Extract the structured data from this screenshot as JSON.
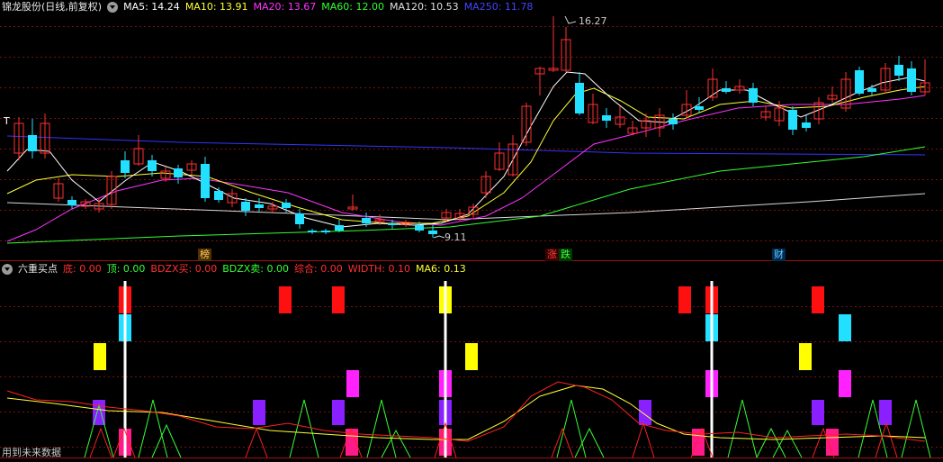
{
  "main_panel": {
    "stock_name": "锦龙股份(日线,前复权)",
    "ma_labels": [
      {
        "text": "MA5: 14.24",
        "color": "#ffffff"
      },
      {
        "text": "MA10: 13.91",
        "color": "#ffff33"
      },
      {
        "text": "MA20: 13.67",
        "color": "#ff33ff"
      },
      {
        "text": "MA60: 12.00",
        "color": "#33ff33"
      },
      {
        "text": "MA120: 10.53",
        "color": "#e0e0e0"
      },
      {
        "text": "MA250: 11.78",
        "color": "#3333ff"
      }
    ],
    "high_label": "16.27",
    "low_label": "9.11",
    "marker_t": "T",
    "event_tags": [
      {
        "text": "榜",
        "color": "#ffcc66",
        "bg": "#503000"
      },
      {
        "text": "涨",
        "color": "#ff4040",
        "bg": "#3a0000"
      },
      {
        "text": "跌",
        "color": "#40ff40",
        "bg": "#003a00"
      },
      {
        "text": "财",
        "color": "#66ccff",
        "bg": "#002a50"
      }
    ],
    "colors": {
      "up": "#ff3030",
      "down": "#22e0ff"
    }
  },
  "sub_panel": {
    "indicator_name": "六重买点",
    "values": [
      {
        "text": "底: 0.00",
        "color": "#ff3030"
      },
      {
        "text": "顶: 0.00",
        "color": "#33ff33"
      },
      {
        "text": "BDZX买: 0.00",
        "color": "#ff3030"
      },
      {
        "text": "BDZX卖: 0.00",
        "color": "#33ff33"
      },
      {
        "text": "综合: 0.00",
        "color": "#ff3030"
      },
      {
        "text": "WIDTH: 0.10",
        "color": "#ff3030"
      },
      {
        "text": "MA6: 0.13",
        "color": "#ffff33"
      }
    ],
    "footer_text": "用到未来数据"
  }
}
